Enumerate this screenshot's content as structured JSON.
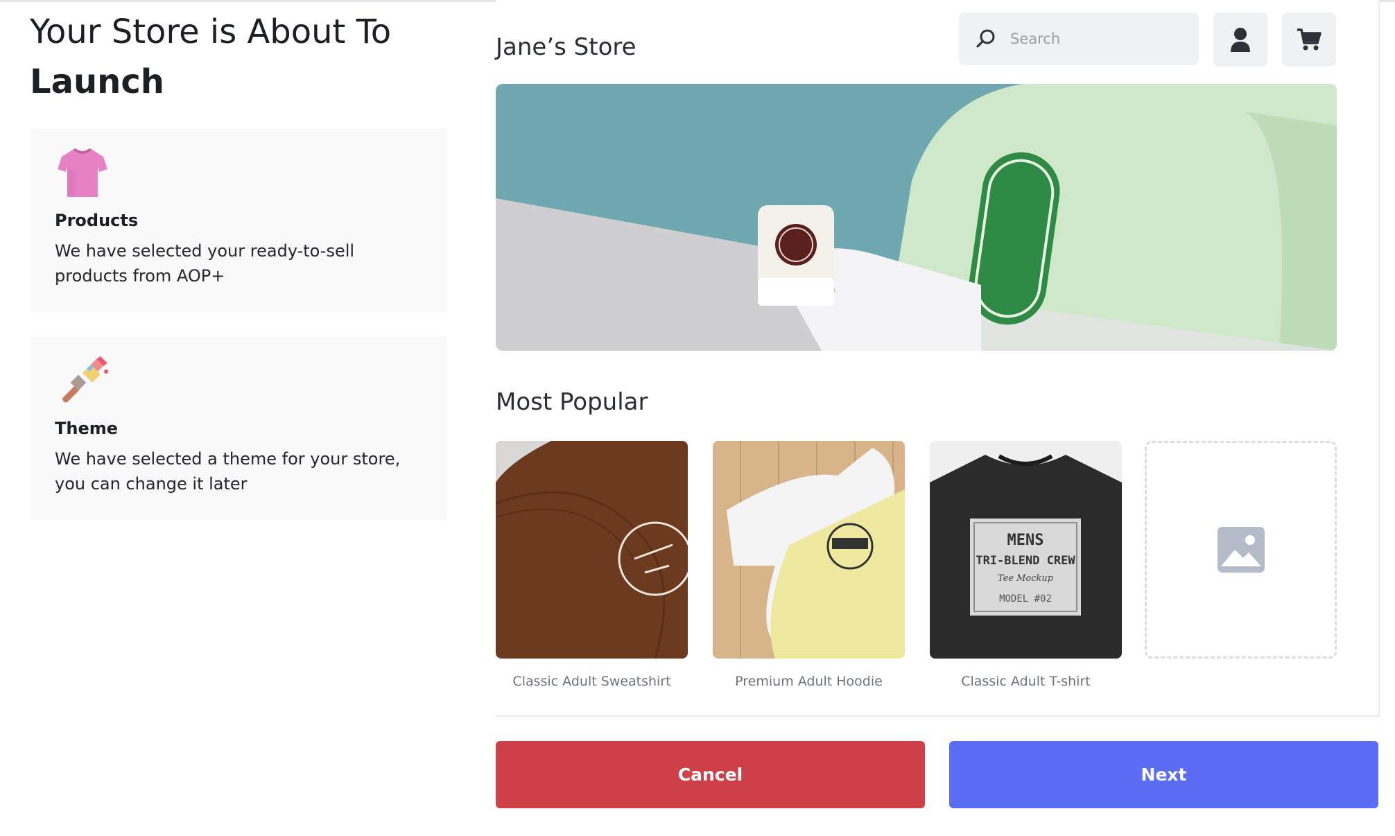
{
  "header": {
    "title_line1": "Your Store is About To",
    "title_line2": "Launch"
  },
  "cards": {
    "products": {
      "icon": "tshirt-icon",
      "title": "Products",
      "description": "We have selected your ready-to-sell products from AOP+"
    },
    "theme": {
      "icon": "paintbrush-icon",
      "title": "Theme",
      "description": "We have selected a theme for your store, you can change it later"
    }
  },
  "store": {
    "name": "Jane’s Store",
    "search_placeholder": "Search",
    "icons": [
      "search-icon",
      "user-icon",
      "cart-icon"
    ],
    "hero_image": "green-sweatshirt-logo-coffee-mug"
  },
  "popular": {
    "title": "Most Popular",
    "products": [
      {
        "label": "Classic Adult Sweatshirt",
        "image": "brown-sweatshirt"
      },
      {
        "label": "Premium Adult Hoodie",
        "image": "white-yellow-hoodie"
      },
      {
        "label": "Classic Adult T-shirt",
        "image": "black-tshirt-mockup"
      }
    ],
    "placeholder_icon": "image-placeholder-icon"
  },
  "actions": {
    "cancel_label": "Cancel",
    "next_label": "Next"
  },
  "colors": {
    "cancel": "#cf4149",
    "next": "#5b6ef3",
    "card_bg": "#f9f9fa",
    "hero_teal": "#6fa8b0",
    "hero_green": "#cfe8c9"
  }
}
